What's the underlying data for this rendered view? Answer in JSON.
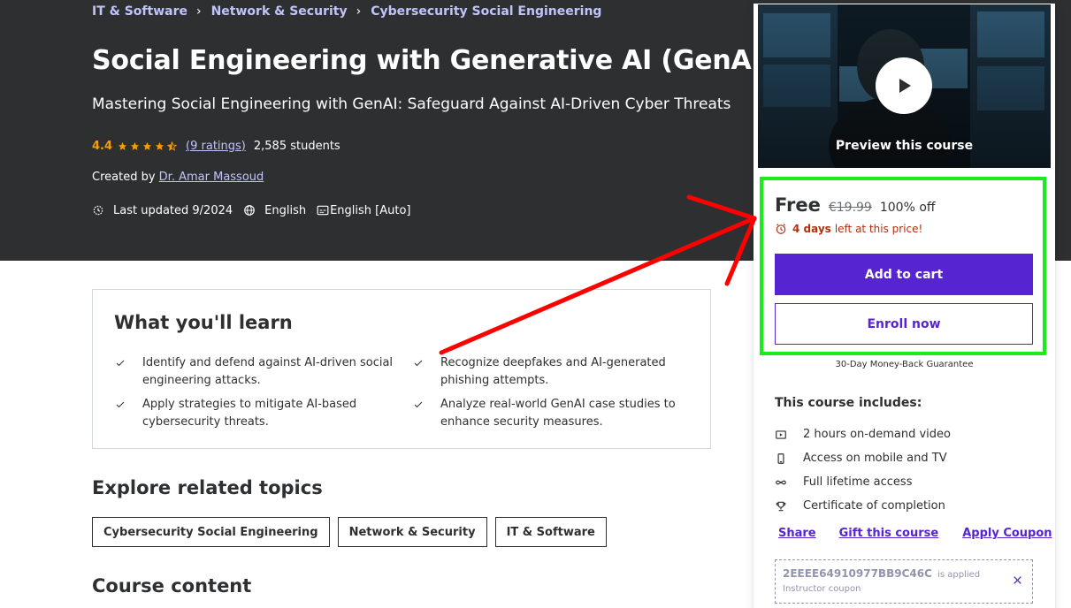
{
  "breadcrumb": [
    "IT & Software",
    "Network & Security",
    "Cybersecurity Social Engineering"
  ],
  "course": {
    "title": "Social Engineering with Generative AI (GenAI)",
    "subtitle": "Mastering Social Engineering with GenAI: Safeguard Against AI-Driven Cyber Threats",
    "rating": "4.4",
    "rating_count": "(9 ratings)",
    "students": "2,585 students",
    "created_by_label": "Created by",
    "author": "Dr. Amar Massoud",
    "last_updated": "Last updated 9/2024",
    "language": "English",
    "captions": "English [Auto]"
  },
  "card": {
    "preview_label": "Preview this course",
    "price_free": "Free",
    "price_original": "€19.99",
    "discount": "100% off",
    "timer_days": "4 days",
    "timer_text": "left at this price!",
    "add_to_cart": "Add to cart",
    "enroll_now": "Enroll now",
    "guarantee": "30-Day Money-Back Guarantee",
    "includes_title": "This course includes:",
    "includes": [
      {
        "icon": "video-icon",
        "text": "2 hours on-demand video"
      },
      {
        "icon": "mobile-icon",
        "text": "Access on mobile and TV"
      },
      {
        "icon": "infinity-icon",
        "text": "Full lifetime access"
      },
      {
        "icon": "trophy-icon",
        "text": "Certificate of completion"
      }
    ],
    "share": "Share",
    "gift": "Gift this course",
    "apply_coupon": "Apply Coupon",
    "coupon_code": "2EEEE64910977BB9C46C",
    "coupon_applied": "is applied",
    "coupon_type": "Instructor coupon"
  },
  "learn": {
    "title": "What you'll learn",
    "points": [
      "Identify and defend against AI-driven social engineering attacks.",
      "Recognize deepfakes and AI-generated phishing attempts.",
      "Apply strategies to mitigate AI-based cybersecurity threats.",
      "Analyze real-world GenAI case studies to enhance security measures."
    ]
  },
  "related": {
    "title": "Explore related topics",
    "topics": [
      "Cybersecurity Social Engineering",
      "Network & Security",
      "IT & Software"
    ]
  },
  "course_content_title": "Course content",
  "colors": {
    "hero_bg": "#2d2f31",
    "accent": "#5624d0",
    "link_light": "#c0c4fc",
    "star": "#f69c08",
    "urgency": "#b32d0f",
    "highlight_box": "#1aee1a",
    "annotation_arrow": "#ff0000"
  }
}
